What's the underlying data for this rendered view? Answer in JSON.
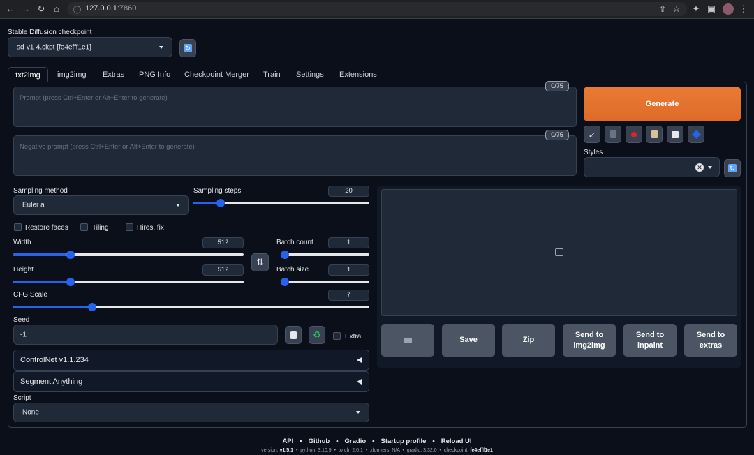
{
  "browser": {
    "url_host": "127.0.0.1",
    "url_port": ":7860"
  },
  "checkpoint": {
    "label": "Stable Diffusion checkpoint",
    "value": "sd-v1-4.ckpt [fe4efff1e1]"
  },
  "tabs": [
    {
      "label": "txt2img"
    },
    {
      "label": "img2img"
    },
    {
      "label": "Extras"
    },
    {
      "label": "PNG Info"
    },
    {
      "label": "Checkpoint Merger"
    },
    {
      "label": "Train"
    },
    {
      "label": "Settings"
    },
    {
      "label": "Extensions"
    }
  ],
  "prompt": {
    "placeholder": "Prompt (press Ctrl+Enter or Alt+Enter to generate)",
    "counter": "0/75"
  },
  "negative_prompt": {
    "placeholder": "Negative prompt (press Ctrl+Enter or Alt+Enter to generate)",
    "counter": "0/75"
  },
  "generate_label": "Generate",
  "styles_label": "Styles",
  "sampling_method": {
    "label": "Sampling method",
    "value": "Euler a"
  },
  "sampling_steps": {
    "label": "Sampling steps",
    "value": "20",
    "fraction": 0.13
  },
  "checks": {
    "restore_faces": "Restore faces",
    "tiling": "Tiling",
    "hires_fix": "Hires. fix"
  },
  "width": {
    "label": "Width",
    "value": "512",
    "fraction": 0.23
  },
  "height": {
    "label": "Height",
    "value": "512",
    "fraction": 0.23
  },
  "batch_count": {
    "label": "Batch count",
    "value": "1",
    "fraction": 0.0
  },
  "batch_size": {
    "label": "Batch size",
    "value": "1",
    "fraction": 0.0
  },
  "cfg_scale": {
    "label": "CFG Scale",
    "value": "7",
    "fraction": 0.21
  },
  "seed": {
    "label": "Seed",
    "value": "-1",
    "extra_label": "Extra"
  },
  "accordions": {
    "controlnet": "ControlNet v1.1.234",
    "segment_anything": "Segment Anything"
  },
  "script": {
    "label": "Script",
    "value": "None"
  },
  "output_buttons": {
    "save": "Save",
    "zip": "Zip",
    "send_img2img_1": "Send to",
    "send_img2img_2": "img2img",
    "send_inpaint_1": "Send to",
    "send_inpaint_2": "inpaint",
    "send_extras_1": "Send to",
    "send_extras_2": "extras"
  },
  "footer": {
    "links": [
      "API",
      "Github",
      "Gradio",
      "Startup profile",
      "Reload UI"
    ],
    "sep": "•",
    "version_label": "version: ",
    "version": "v1.5.1",
    "python_label": "python: 3.10.9",
    "torch_label": "torch: 2.0.1",
    "xformers_label": "xformers: N/A",
    "gradio_label": "gradio: 3.32.0",
    "checkpoint_label": "checkpoint: ",
    "checkpoint": "fe4efff1e1"
  },
  "colors": {
    "background": "#0b0f19",
    "accent_orange": "#e8732e",
    "slider_blue": "#2563eb"
  }
}
